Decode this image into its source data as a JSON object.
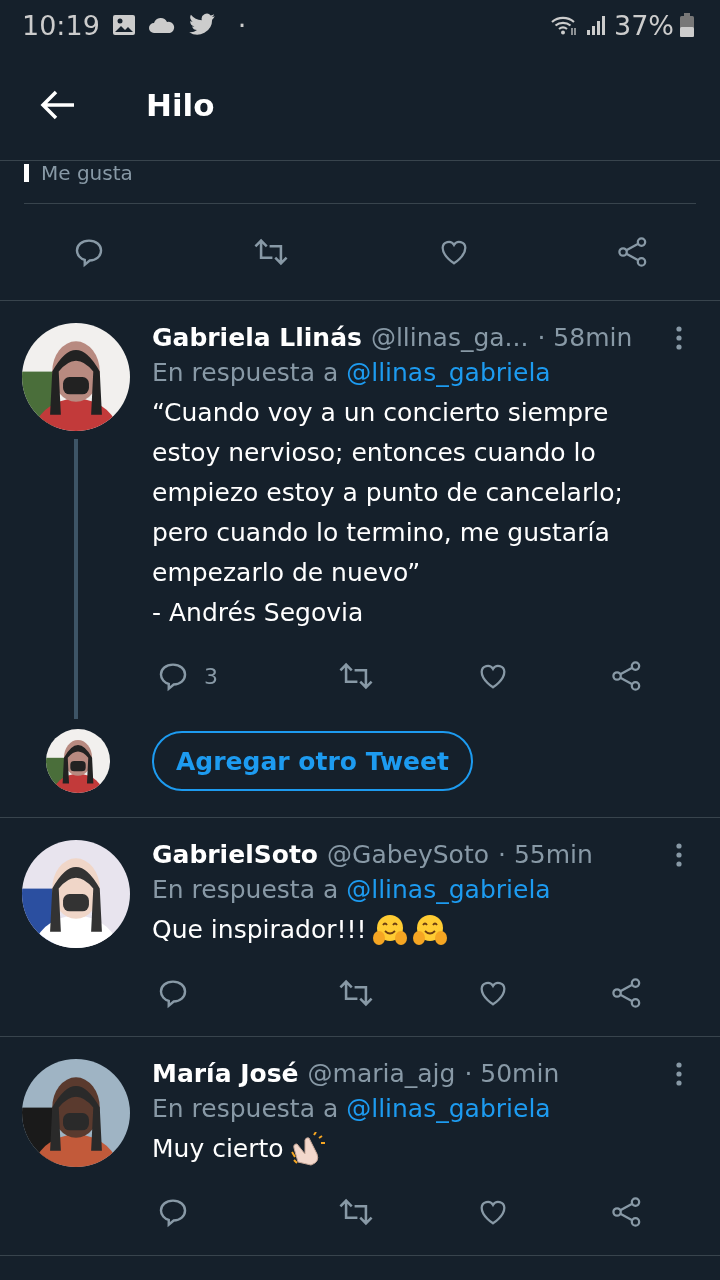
{
  "status_bar": {
    "time": "10:19",
    "dot": "·",
    "battery": "37%"
  },
  "header": {
    "title": "Hilo"
  },
  "previous_stats": {
    "label": "Me gusta"
  },
  "tweets": [
    {
      "name": "Gabriela Llinás",
      "handle": "@llinas_ga...",
      "time": "· 58min",
      "reply_prefix": "En respuesta a",
      "reply_to": "@llinas_gabriela",
      "lines": [
        "“Cuando voy a un concierto siempre estoy nervioso; entonces cuando lo empiezo estoy a punto de cancelarlo; pero cuando lo termino, me gustaría empezarlo de nuevo”",
        "- Andrés Segovia"
      ],
      "reply_count": "3",
      "thread": true
    },
    {
      "name": "GabrielSoto",
      "handle": "@GabeySoto",
      "time": "· 55min",
      "reply_prefix": "En respuesta a",
      "reply_to": "@llinas_gabriela",
      "lines": [
        "Que inspirador!!!"
      ],
      "reactions": [
        {
          "kind": "hug"
        },
        {
          "kind": "hug"
        }
      ],
      "thread": false
    },
    {
      "name": "María José",
      "handle": "@maria_ajg",
      "time": "· 50min",
      "reply_prefix": "En respuesta a",
      "reply_to": "@llinas_gabriela",
      "lines": [
        "Muy cierto"
      ],
      "reactions": [
        {
          "kind": "clap"
        }
      ],
      "thread": false
    }
  ],
  "add_tweet": {
    "label": "Agregar otro Tweet"
  }
}
